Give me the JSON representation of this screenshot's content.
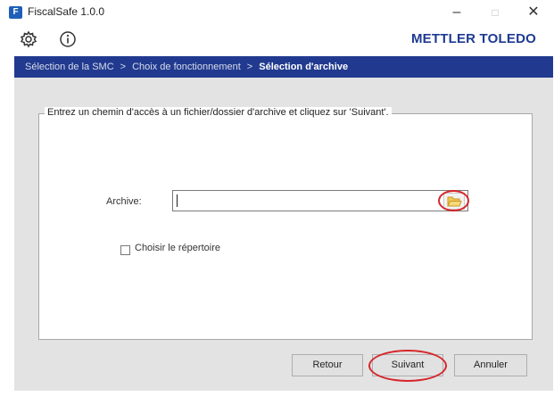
{
  "window": {
    "title": "FiscalSafe 1.0.0",
    "minimize": "–",
    "maximize": "□",
    "close": "✕"
  },
  "toolbar": {
    "brand": "METTLER TOLEDO",
    "settings_icon": "gear-icon",
    "info_icon": "info-icon"
  },
  "breadcrumb": {
    "steps": [
      "Sélection de la SMC",
      "Choix de fonctionnement",
      "Sélection d'archive"
    ],
    "separator": ">"
  },
  "form": {
    "instruction": "Entrez un chemin d'accès à un fichier/dossier d'archive et cliquez sur 'Suivant'.",
    "archive_label": "Archive:",
    "archive_value": "",
    "checkbox_label": "Choisir le répertoire",
    "checkbox_checked": false
  },
  "buttons": {
    "back": "Retour",
    "next": "Suivant",
    "cancel": "Annuler"
  },
  "colors": {
    "brand": "#1f3a93",
    "breadcrumb_bg": "#213a8f",
    "highlight": "#d6262b"
  }
}
